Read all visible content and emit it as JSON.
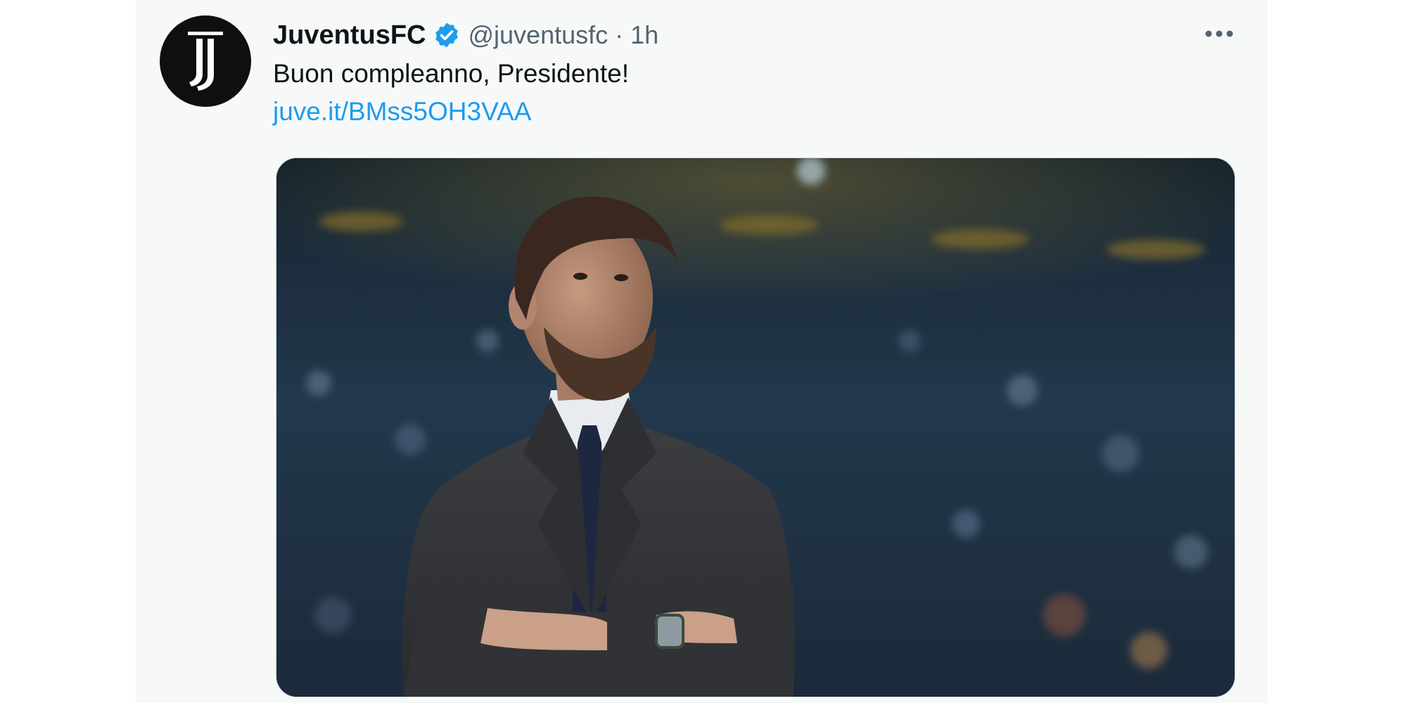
{
  "tweet": {
    "author_name": "JuventusFC",
    "verified": true,
    "handle": "@juventusfc",
    "separator": "·",
    "time": "1h",
    "text": "Buon compleanno, Presidente!",
    "link": "juve.it/BMss5OH3VAA",
    "avatar_icon": "juventus-logo-icon",
    "more_icon": "more-options-icon",
    "verified_icon": "verified-badge-icon",
    "media_description": "photo"
  },
  "colors": {
    "link": "#1d9bf0",
    "verified": "#1d9bf0",
    "text_primary": "#0f1419",
    "text_secondary": "#536471",
    "card_background": "#f7f9f9"
  }
}
